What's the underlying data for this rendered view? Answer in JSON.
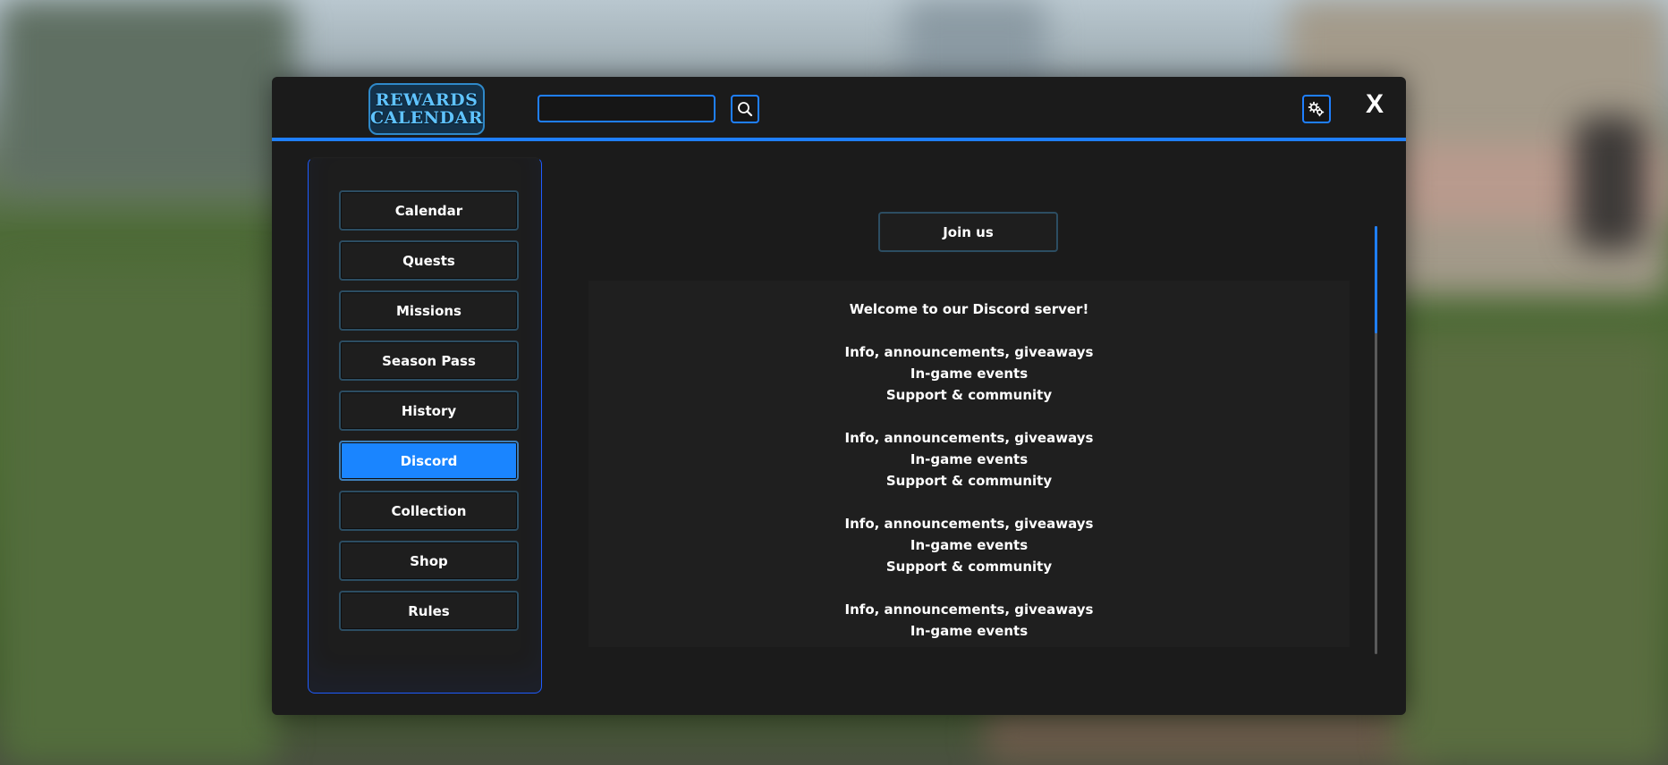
{
  "logo": {
    "line1": "REWARDS",
    "line2": "CALENDAR"
  },
  "search": {
    "value": "",
    "placeholder": ""
  },
  "icons": {
    "search": "search-icon",
    "settings": "gear-icon",
    "close": "close-icon"
  },
  "close_label": "X",
  "sidebar": {
    "items": [
      {
        "label": "Calendar",
        "active": false
      },
      {
        "label": "Quests",
        "active": false
      },
      {
        "label": "Missions",
        "active": false
      },
      {
        "label": "Season Pass",
        "active": false
      },
      {
        "label": "History",
        "active": false
      },
      {
        "label": "Discord",
        "active": true
      },
      {
        "label": "Collection",
        "active": false
      },
      {
        "label": "Shop",
        "active": false
      },
      {
        "label": "Rules",
        "active": false
      }
    ]
  },
  "main": {
    "join_label": "Join us",
    "welcome": "Welcome to our Discord server!",
    "blocks": [
      [
        "Info, announcements, giveaways",
        "In-game events",
        "Support & community"
      ],
      [
        "Info, announcements, giveaways",
        "In-game events",
        "Support & community"
      ],
      [
        "Info, announcements, giveaways",
        "In-game events",
        "Support & community"
      ],
      [
        "Info, announcements, giveaways",
        "In-game events"
      ]
    ]
  },
  "colors": {
    "accent": "#1f7fff",
    "active_button": "#1a85ff",
    "panel": "#1b1b1b"
  },
  "scroll": {
    "position": 0.0,
    "visible_fraction": 0.25
  }
}
